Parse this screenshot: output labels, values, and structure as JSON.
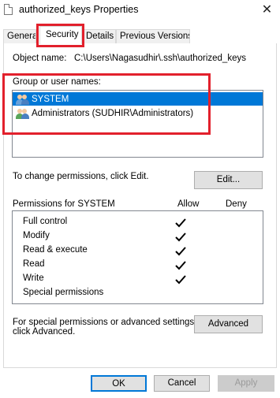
{
  "window": {
    "title": "authorized_keys Properties",
    "close_glyph": "✕"
  },
  "tabs": [
    {
      "label": "General"
    },
    {
      "label": "Security"
    },
    {
      "label": "Details"
    },
    {
      "label": "Previous Versions"
    }
  ],
  "security": {
    "object_name_label": "Object name:",
    "object_name_value": "C:\\Users\\Nagasudhir\\.ssh\\authorized_keys",
    "group_label": "Group or user names:",
    "principals": [
      {
        "name": "SYSTEM",
        "icon": "users-group-icon",
        "selected": true
      },
      {
        "name": "Administrators (SUDHIR\\Administrators)",
        "icon": "users-group-icon",
        "selected": false
      }
    ],
    "change_text": "To change permissions, click Edit.",
    "edit_button": "Edit...",
    "permissions_header": "Permissions for SYSTEM",
    "allow_header": "Allow",
    "deny_header": "Deny",
    "permissions": [
      {
        "name": "Full control",
        "allow": true,
        "deny": false
      },
      {
        "name": "Modify",
        "allow": true,
        "deny": false
      },
      {
        "name": "Read & execute",
        "allow": true,
        "deny": false
      },
      {
        "name": "Read",
        "allow": true,
        "deny": false
      },
      {
        "name": "Write",
        "allow": true,
        "deny": false
      },
      {
        "name": "Special permissions",
        "allow": false,
        "deny": false
      }
    ],
    "advanced_text_line1": "For special permissions or advanced settings,",
    "advanced_text_line2": "click Advanced.",
    "advanced_button": "Advanced"
  },
  "footer": {
    "ok": "OK",
    "cancel": "Cancel",
    "apply": "Apply"
  },
  "colors": {
    "highlight": "#e2202c",
    "selection": "#0078d7"
  }
}
